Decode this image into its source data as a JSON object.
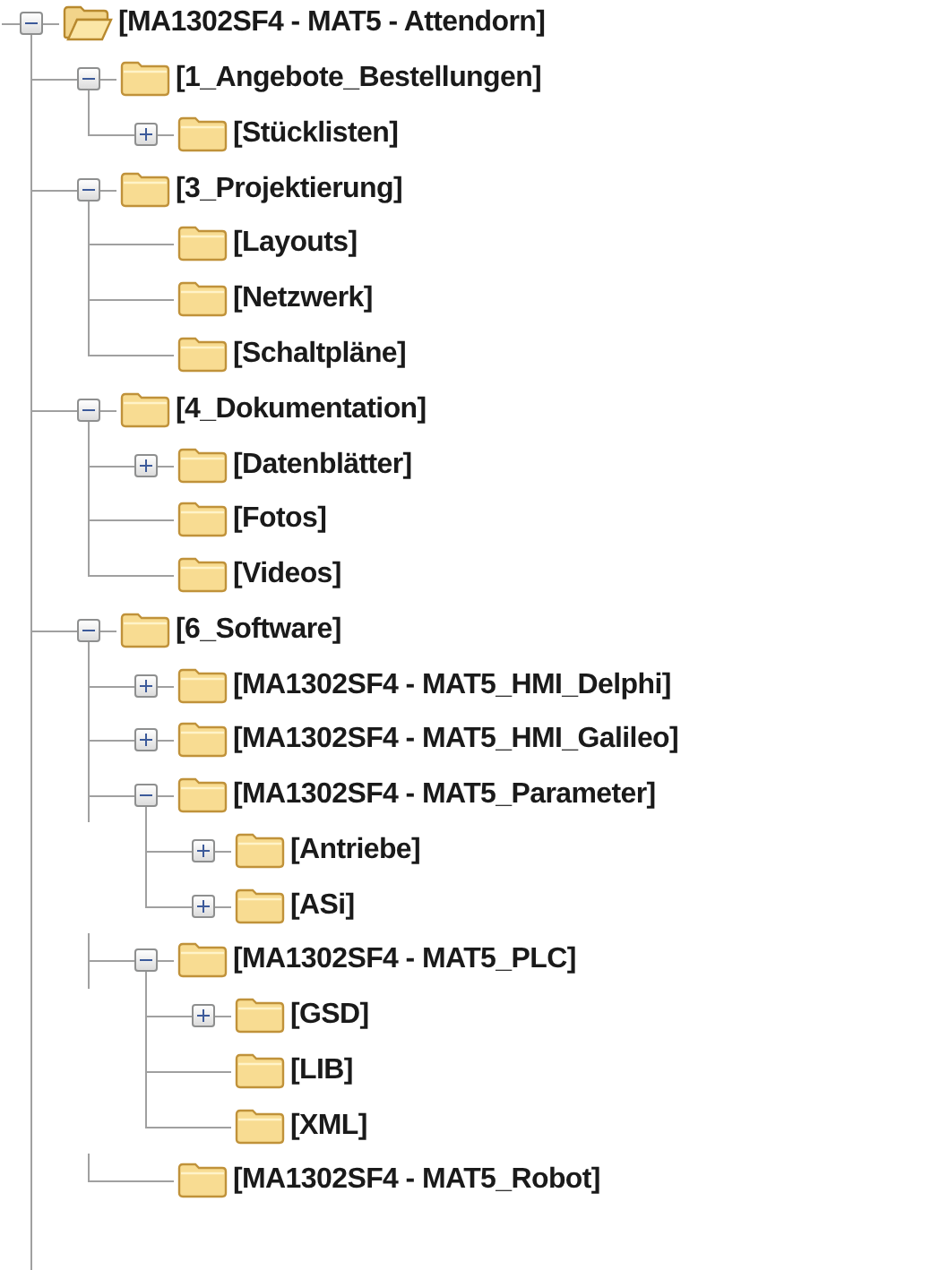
{
  "tree": [
    {
      "label": "[MA1302SF4 - MAT5 - Attendorn]",
      "kind": "open-folder",
      "expanded": true,
      "children": [
        {
          "label": "[1_Angebote_Bestellungen]",
          "kind": "folder",
          "expanded": true,
          "children": [
            {
              "label": "[Stücklisten]",
              "kind": "folder",
              "expanded": false
            }
          ]
        },
        {
          "label": "[3_Projektierung]",
          "kind": "folder",
          "expanded": true,
          "children": [
            {
              "label": "[Layouts]",
              "kind": "folder"
            },
            {
              "label": "[Netzwerk]",
              "kind": "folder"
            },
            {
              "label": "[Schaltpläne]",
              "kind": "folder"
            }
          ]
        },
        {
          "label": "[4_Dokumentation]",
          "kind": "folder",
          "expanded": true,
          "children": [
            {
              "label": "[Datenblätter]",
              "kind": "folder",
              "expanded": false
            },
            {
              "label": "[Fotos]",
              "kind": "folder"
            },
            {
              "label": "[Videos]",
              "kind": "folder"
            }
          ]
        },
        {
          "label": "[6_Software]",
          "kind": "folder",
          "expanded": true,
          "children": [
            {
              "label": "[MA1302SF4 - MAT5_HMI_Delphi]",
              "kind": "folder",
              "expanded": false
            },
            {
              "label": "[MA1302SF4 - MAT5_HMI_Galileo]",
              "kind": "folder",
              "expanded": false
            },
            {
              "label": "[MA1302SF4 - MAT5_Parameter]",
              "kind": "folder",
              "expanded": true,
              "children": [
                {
                  "label": "[Antriebe]",
                  "kind": "folder",
                  "expanded": false
                },
                {
                  "label": "[ASi]",
                  "kind": "folder",
                  "expanded": false
                }
              ]
            },
            {
              "label": "[MA1302SF4 - MAT5_PLC]",
              "kind": "folder",
              "expanded": true,
              "children": [
                {
                  "label": "[GSD]",
                  "kind": "folder",
                  "expanded": false
                },
                {
                  "label": "[LIB]",
                  "kind": "folder"
                },
                {
                  "label": "[XML]",
                  "kind": "folder"
                }
              ]
            },
            {
              "label": "[MA1302SF4 - MAT5_Robot]",
              "kind": "folder"
            }
          ]
        }
      ]
    }
  ]
}
